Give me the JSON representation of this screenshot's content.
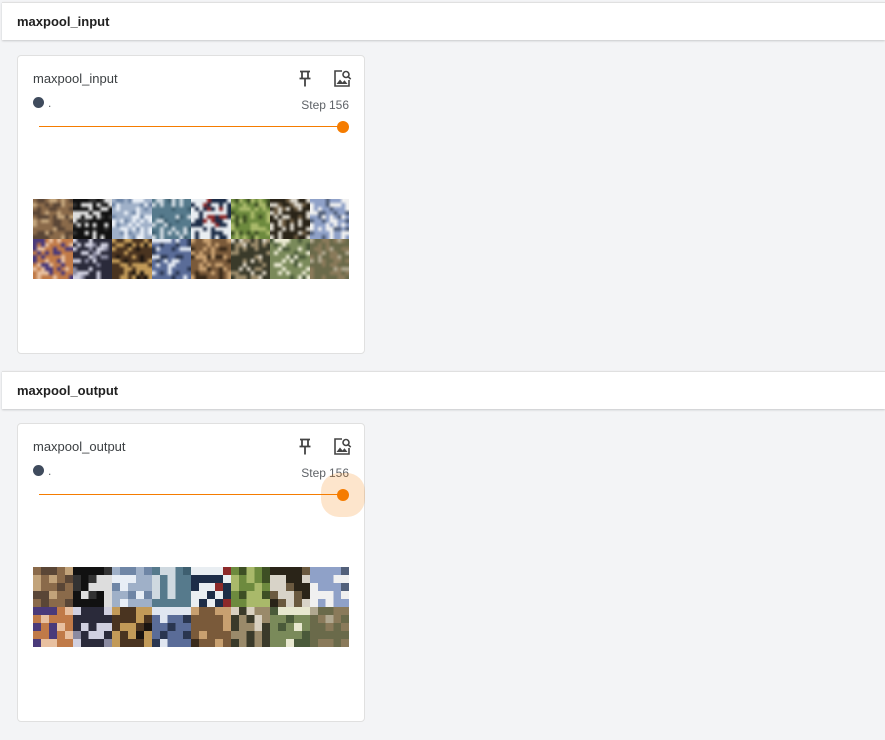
{
  "sections": [
    {
      "header": "maxpool_input",
      "card": {
        "title": "maxpool_input",
        "run_name": ".",
        "step_prefix": "Step",
        "step_value": "156",
        "slider_fraction": 1.0,
        "pixelated": false,
        "thumb_icons": [
          "cat-image-icon",
          "dog-image-icon",
          "ship-image-icon",
          "airplane-image-icon",
          "ship-image-icon",
          "deer-image-icon",
          "horse-image-icon",
          "airplane-image-icon",
          "cat-image-icon",
          "dog-image-icon",
          "cat-image-icon",
          "bird-image-icon",
          "dog-image-icon",
          "dog-image-icon",
          "truck-image-icon",
          "horse-image-icon"
        ]
      }
    },
    {
      "header": "maxpool_output",
      "card": {
        "title": "maxpool_output",
        "run_name": ".",
        "step_prefix": "Step",
        "step_value": "156",
        "slider_fraction": 1.0,
        "pixelated": true,
        "thumb_icons": [
          "cat-image-icon",
          "dog-image-icon",
          "ship-image-icon",
          "airplane-image-icon",
          "ship-image-icon",
          "deer-image-icon",
          "horse-image-icon",
          "airplane-image-icon",
          "cat-image-icon",
          "dog-image-icon",
          "cat-image-icon",
          "bird-image-icon",
          "dog-image-icon",
          "dog-image-icon",
          "truck-image-icon",
          "horse-image-icon"
        ]
      }
    }
  ],
  "icons": {
    "pin": "pin-icon",
    "zoom": "image-search-icon"
  },
  "colors": {
    "accent": "#f57c00",
    "run_dot": "#3f4b5d",
    "background": "#f3f4f6",
    "card": "#ffffff"
  }
}
